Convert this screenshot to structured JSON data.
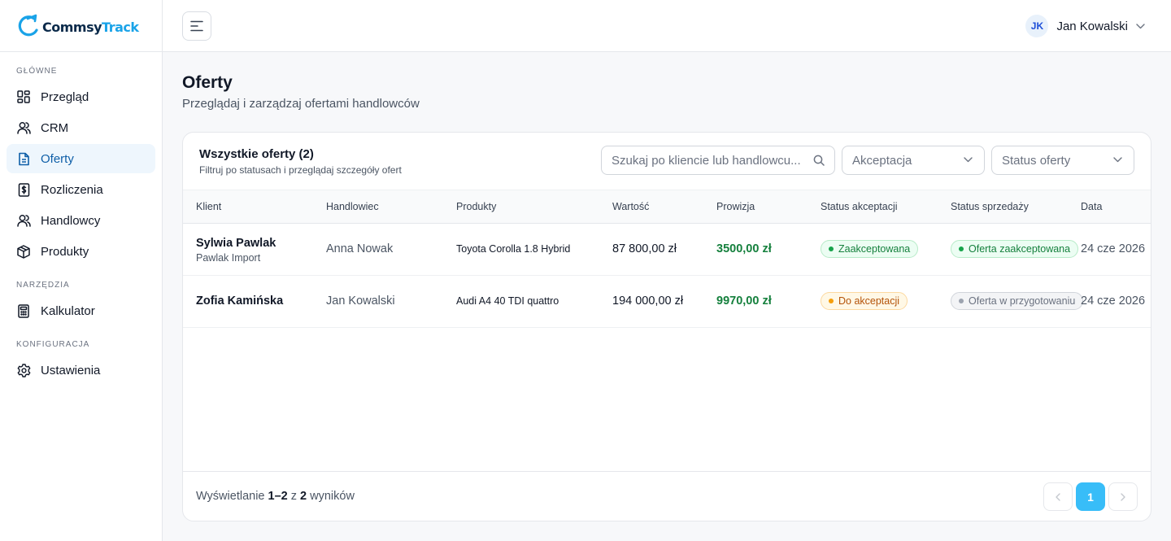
{
  "app": {
    "logo_part1": "Commsy",
    "logo_part2": "Track"
  },
  "sidebar": {
    "sections": [
      {
        "label": "GŁÓWNE"
      },
      {
        "label": "NARZĘDZIA"
      },
      {
        "label": "KONFIGURACJA"
      }
    ],
    "items": [
      {
        "label": "Przegląd",
        "icon": "dashboard-icon"
      },
      {
        "label": "CRM",
        "icon": "contacts-icon"
      },
      {
        "label": "Oferty",
        "icon": "document-icon",
        "active": true
      },
      {
        "label": "Rozliczenia",
        "icon": "billing-icon"
      },
      {
        "label": "Handlowcy",
        "icon": "users-icon"
      },
      {
        "label": "Produkty",
        "icon": "box-icon"
      },
      {
        "label": "Kalkulator",
        "icon": "calculator-icon"
      },
      {
        "label": "Ustawienia",
        "icon": "gear-icon"
      }
    ]
  },
  "topbar": {
    "user_initials": "JK",
    "user_name": "Jan Kowalski"
  },
  "page": {
    "title": "Oferty",
    "subtitle": "Przeglądaj i zarządzaj ofertami handlowców"
  },
  "card": {
    "title": "Wszystkie oferty (2)",
    "subtitle": "Filtruj po statusach i przeglądaj szczegóły ofert",
    "search_placeholder": "Szukaj po kliencie lub handlowcu...",
    "filter_acceptance": "Akceptacja",
    "filter_status": "Status oferty"
  },
  "table": {
    "headers": [
      "Klient",
      "Handlowiec",
      "Produkty",
      "Wartość",
      "Prowizja",
      "Status akceptacji",
      "Status sprzedaży",
      "Data"
    ],
    "rows": [
      {
        "client": "Sylwia Pawlak",
        "company": "Pawlak Import",
        "seller": "Anna Nowak",
        "product": "Toyota Corolla 1.8 Hybrid",
        "value": "87 800,00 zł",
        "commission": "3500,00 zł",
        "acceptance": "Zaakceptowana",
        "sale_status": "Oferta zaakceptowana",
        "date": "24 cze 2026"
      },
      {
        "client": "Zofia Kamińska",
        "company": "",
        "seller": "Jan Kowalski",
        "product": "Audi A4 40 TDI quattro",
        "value": "194 000,00 zł",
        "commission": "9970,00 zł",
        "acceptance": "Do akceptacji",
        "sale_status": "Oferta w przygotowaniu",
        "date": "24 cze 2026"
      }
    ]
  },
  "footer": {
    "prefix": "Wyświetlanie",
    "range": "1–2",
    "of": "z",
    "total": "2",
    "suffix": "wyników",
    "current_page": "1"
  },
  "colors": {
    "accent": "#0f5fa8",
    "active_bg": "#eef6fd",
    "page_button": "#38bdf8",
    "commission": "#15803d"
  }
}
